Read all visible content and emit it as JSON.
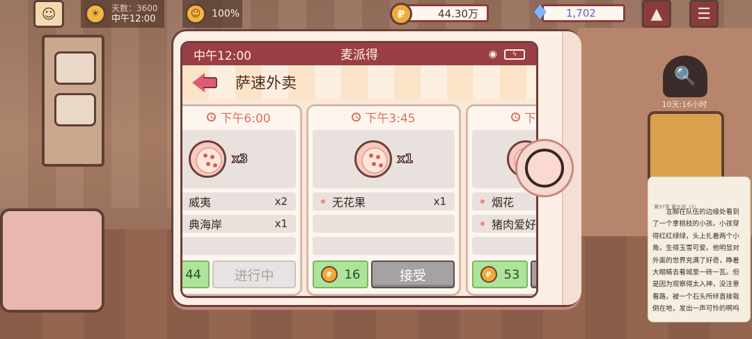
{
  "hud": {
    "days_label": "天数：3600",
    "time_label": "中午12:00",
    "mood_percent": "100%",
    "coins": "44.30万",
    "gems": "1,702",
    "timer_label": "10天:16小时"
  },
  "phone": {
    "status_time": "中午12:00",
    "app_name": "麦派得",
    "page_title": "萨速外卖"
  },
  "orders": [
    {
      "time": "下午6:00",
      "pizza_qty": "x3",
      "items": [
        {
          "name": "威夷",
          "count": "x2"
        },
        {
          "name": "典海岸",
          "count": "x1"
        },
        {
          "name": "",
          "count": ""
        }
      ],
      "reward": "44",
      "action_label": "进行中"
    },
    {
      "time": "下午3:45",
      "pizza_qty": "x1",
      "items": [
        {
          "name": "无花果",
          "count": "x1"
        },
        {
          "name": "",
          "count": ""
        },
        {
          "name": "",
          "count": ""
        }
      ],
      "reward": "16",
      "action_label": "接受"
    },
    {
      "time": "下",
      "pizza_qty": "",
      "items": [
        {
          "name": "烟花",
          "count": ""
        },
        {
          "name": "猪肉爱好",
          "count": ""
        },
        {
          "name": "",
          "count": ""
        }
      ],
      "reward": "53",
      "action_label": ""
    }
  ],
  "reader": {
    "chapter": "第97章 第五战（2）",
    "text": "言脚在队伍的边缘处看到了一个拿桃枝的小孩。小孩穿得红红绿绿，头上扎着两个小角，生得玉雪可爱。他明显对外面的世界充满了好奇，睁着大眼睛去看城里一砖一瓦。但是因为观察得太入神，没注意看路，被一个石头所绊直接栽倒在地，发出一声可怜的啊呜"
  },
  "colors": {
    "status_bar": "#9a3e45",
    "accent_pink": "#e05a78",
    "reward_green": "#aee39a",
    "accept_gray": "#a4a2a2"
  }
}
